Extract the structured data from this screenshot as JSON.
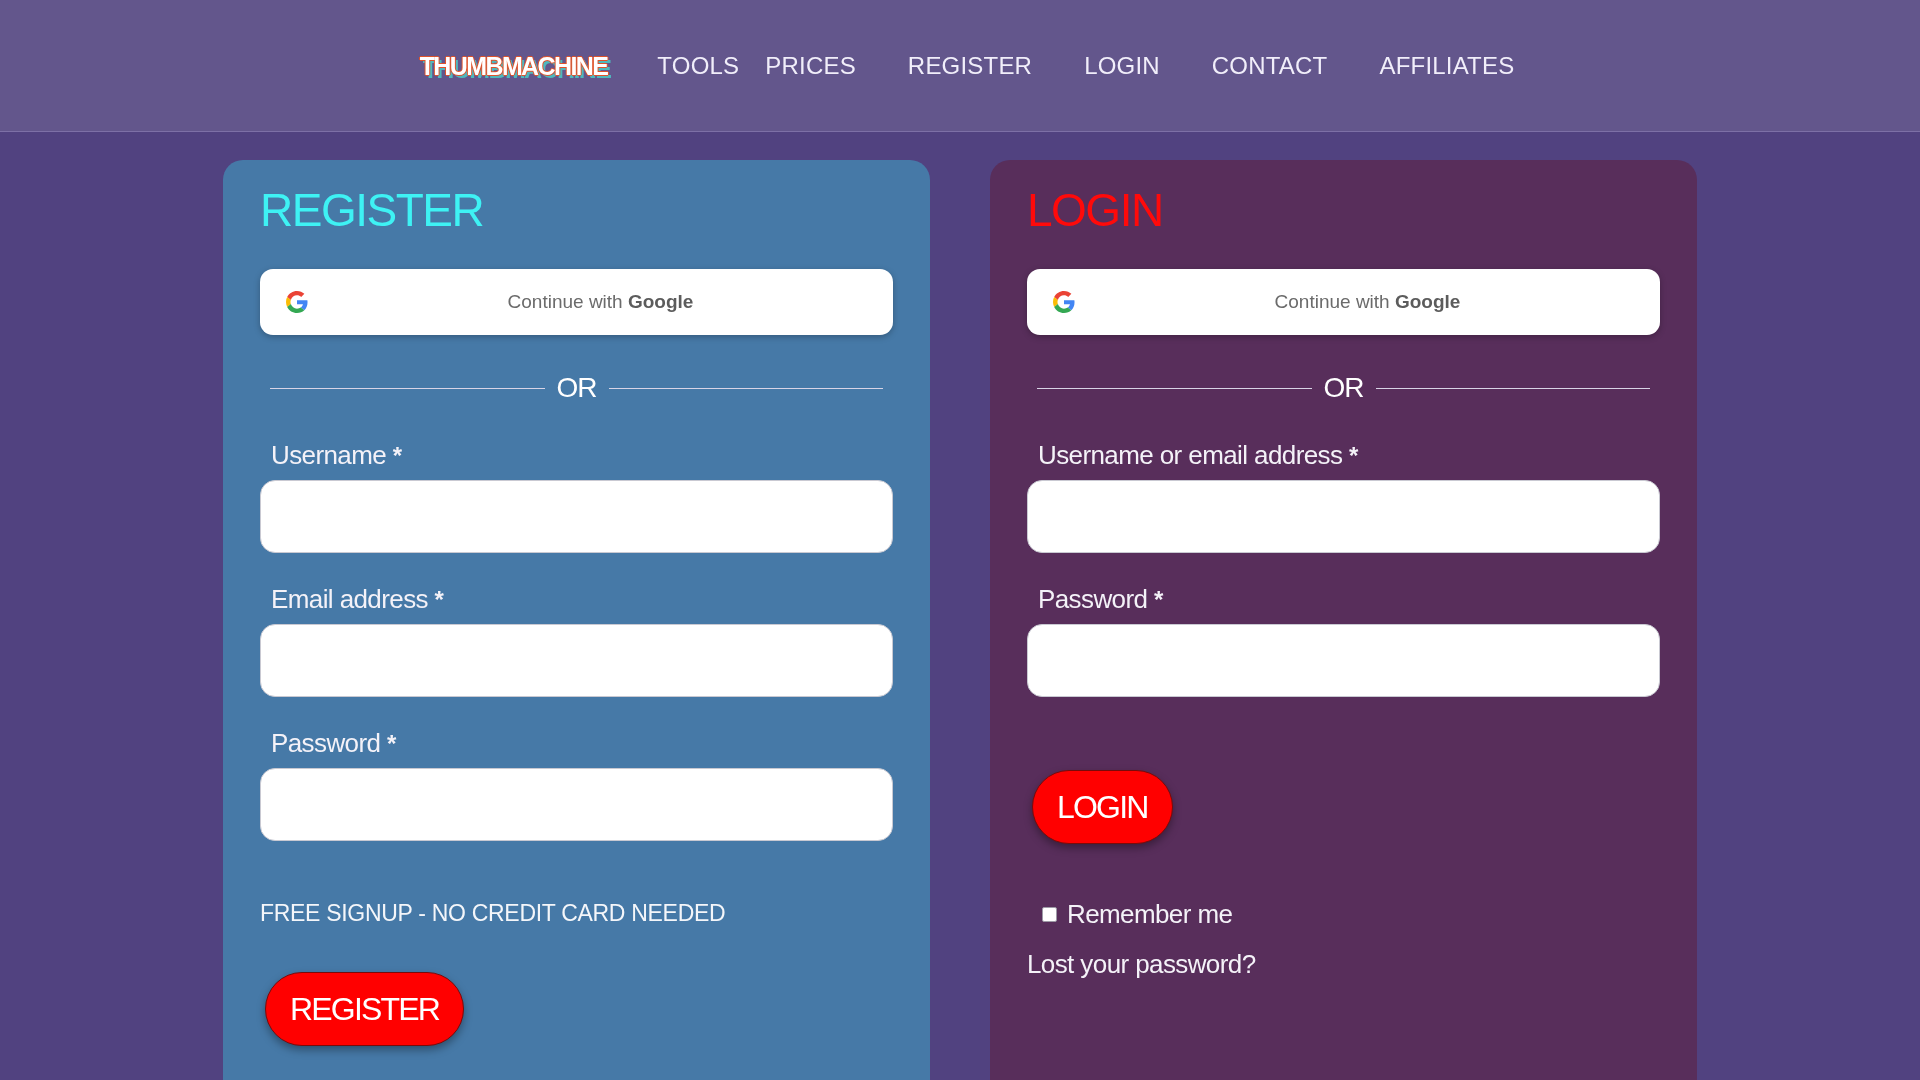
{
  "header": {
    "logo": "THUMBMACHINE",
    "nav": [
      "TOOLS",
      "PRICES",
      "REGISTER",
      "LOGIN",
      "CONTACT",
      "AFFILIATES"
    ]
  },
  "register": {
    "title": "REGISTER",
    "google_button": "Continue with **Google**",
    "divider": "OR",
    "fields": [
      {
        "label": "Username",
        "required_mark": "*"
      },
      {
        "label": "Email address",
        "required_mark": "*"
      },
      {
        "label": "Password",
        "required_mark": "*"
      }
    ],
    "note": "FREE SIGNUP - NO CREDIT CARD NEEDED",
    "submit_button": "REGISTER"
  },
  "login": {
    "title": "LOGIN",
    "google_button": "Continue with **Google**",
    "divider": "OR",
    "fields": [
      {
        "label": "Username or email address",
        "required_mark": "*"
      },
      {
        "label": "Password",
        "required_mark": "*"
      }
    ],
    "submit_button": "LOGIN",
    "remember_me": {
      "label": "Remember me",
      "checked": false
    },
    "lost_password_link": "Lost your password?"
  }
}
